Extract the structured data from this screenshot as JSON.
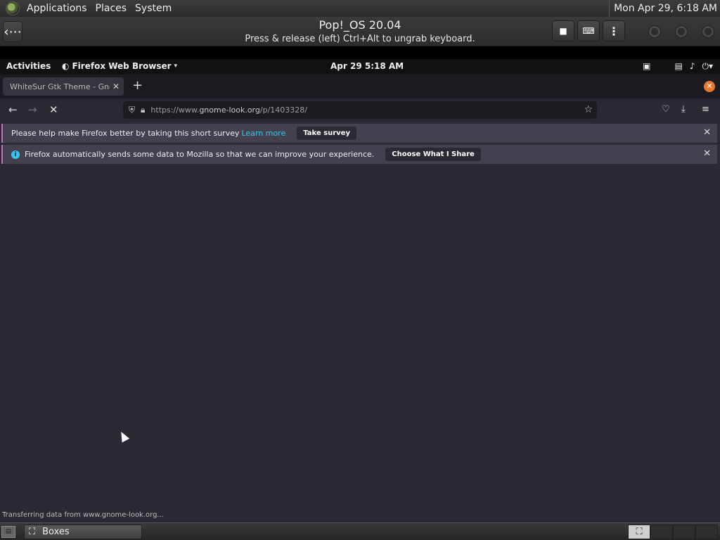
{
  "host_panel": {
    "menus": [
      "Applications",
      "Places",
      "System"
    ],
    "clock": "Mon Apr 29,  6:18 AM"
  },
  "boxes": {
    "title": "Pop!_OS 20.04",
    "subtitle": "Press & release (left) Ctrl+Alt to ungrab keyboard.",
    "back_icon": "back-arrow-icon",
    "buttons": [
      "stop-icon",
      "keyboard-icon",
      "more-vertical-icon"
    ]
  },
  "gnome": {
    "activities": "Activities",
    "app_name": "Firefox Web Browser",
    "clock": "Apr 29   5:18 AM"
  },
  "firefox": {
    "tab_title": "WhiteSur Gtk Theme - Gnome-look.org",
    "url_prefix": "https://www.",
    "url_host": "gnome-look.org",
    "url_path": "/p/1403328/",
    "notification_survey": {
      "text": "Please help make Firefox better by taking this short survey",
      "link": "Learn more",
      "button": "Take survey"
    },
    "notification_data": {
      "text": "Firefox automatically sends some data to Mozilla so that we can improve your experience.",
      "button": "Choose What I Share"
    },
    "status": "Transferring data from www.gnome-look.org..."
  },
  "taskbar": {
    "task_label": "Boxes"
  },
  "colors": {
    "ff_background": "#2b2a33",
    "ff_link": "#38c5f1",
    "notif_accent": "#c96ec7",
    "private_badge": "#e8772b"
  }
}
